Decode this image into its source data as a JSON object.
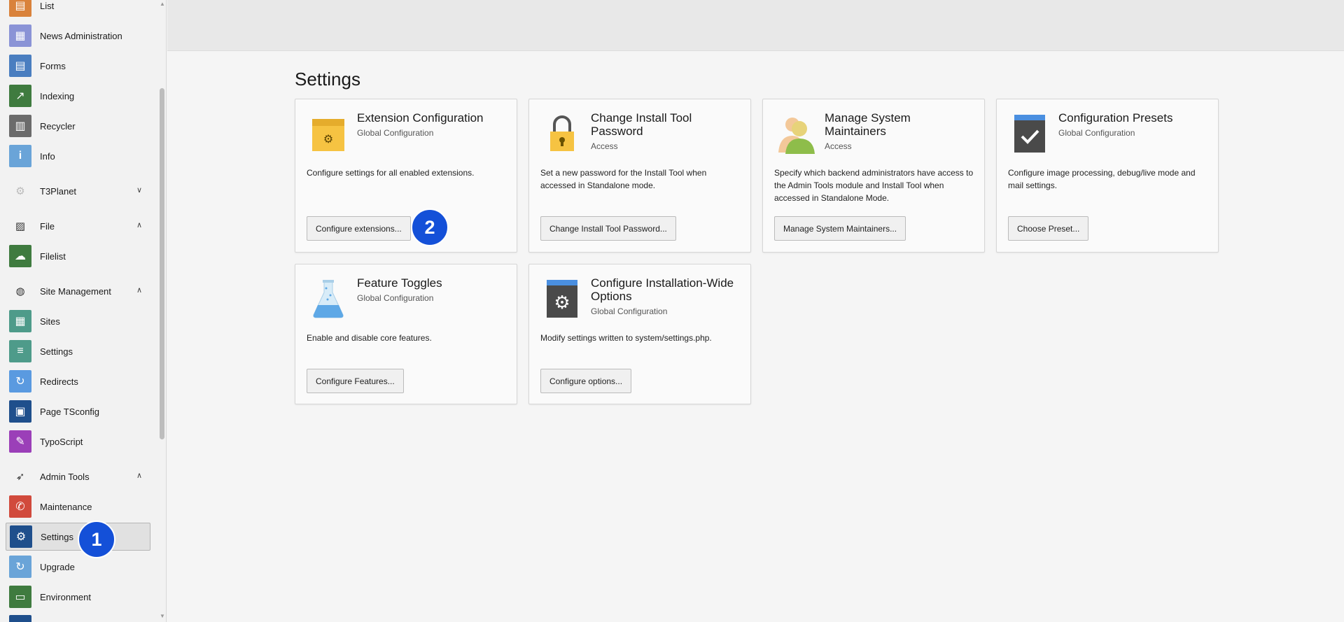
{
  "sidebar": {
    "items": [
      {
        "id": "list",
        "label": "List",
        "icon": "list-icon",
        "color": "#d9823b",
        "glyph": "▤"
      },
      {
        "id": "news",
        "label": "News Administration",
        "icon": "news-icon",
        "color": "#8a93d6",
        "glyph": "▦"
      },
      {
        "id": "forms",
        "label": "Forms",
        "icon": "forms-icon",
        "color": "#4a7ec0",
        "glyph": "▤"
      },
      {
        "id": "indexing",
        "label": "Indexing",
        "icon": "indexing-icon",
        "color": "#3f7b3f",
        "glyph": "↗"
      },
      {
        "id": "recycler",
        "label": "Recycler",
        "icon": "trash-icon",
        "color": "#6b6b6b",
        "glyph": "▥"
      },
      {
        "id": "info",
        "label": "Info",
        "icon": "info-icon",
        "color": "#6aa4d8",
        "glyph": "i"
      },
      {
        "id": "filelist",
        "label": "Filelist",
        "icon": "cloud-icon",
        "color": "#3f7b3f",
        "glyph": "☁"
      },
      {
        "id": "sites",
        "label": "Sites",
        "icon": "sites-icon",
        "color": "#4e9b8a",
        "glyph": "▦"
      },
      {
        "id": "settings-site",
        "label": "Settings",
        "icon": "sliders-icon",
        "color": "#4e9b8a",
        "glyph": "≡"
      },
      {
        "id": "redirects",
        "label": "Redirects",
        "icon": "redirect-icon",
        "color": "#5a9ae0",
        "glyph": "↻"
      },
      {
        "id": "page-tsconfig",
        "label": "Page TSconfig",
        "icon": "tsconfig-icon",
        "color": "#1f4f8c",
        "glyph": "▣"
      },
      {
        "id": "typoscript",
        "label": "TypoScript",
        "icon": "typoscript-icon",
        "color": "#9b3fb8",
        "glyph": "✎"
      },
      {
        "id": "maintenance",
        "label": "Maintenance",
        "icon": "wrench-icon",
        "color": "#d14a3c",
        "glyph": "✆"
      },
      {
        "id": "settings-admin",
        "label": "Settings",
        "icon": "gear-icon",
        "color": "#1f4f8c",
        "glyph": "⚙"
      },
      {
        "id": "upgrade",
        "label": "Upgrade",
        "icon": "upgrade-icon",
        "color": "#6aa4d8",
        "glyph": "↻"
      },
      {
        "id": "environment",
        "label": "Environment",
        "icon": "environment-icon",
        "color": "#3f7b3f",
        "glyph": "▭"
      }
    ],
    "groups": [
      {
        "id": "t3planet",
        "label": "T3Planet",
        "icon": "t3planet-icon",
        "chevron": "chevron-down-icon"
      },
      {
        "id": "file",
        "label": "File",
        "icon": "image-icon",
        "chevron": "chevron-up-icon"
      },
      {
        "id": "site-management",
        "label": "Site Management",
        "icon": "globe-icon",
        "chevron": "chevron-up-icon"
      },
      {
        "id": "admin-tools",
        "label": "Admin Tools",
        "icon": "rocket-icon",
        "chevron": "chevron-up-icon"
      }
    ]
  },
  "main": {
    "title": "Settings",
    "cards": [
      {
        "title": "Extension Configuration",
        "subtitle": "Global Configuration",
        "description": "Configure settings for all enabled extensions.",
        "button": "Configure extensions...",
        "icon": "extension-box-icon"
      },
      {
        "title": "Change Install Tool Password",
        "subtitle": "Access",
        "description": "Set a new password for the Install Tool when accessed in Standalone mode.",
        "button": "Change Install Tool Password...",
        "icon": "lock-icon"
      },
      {
        "title": "Manage System Maintainers",
        "subtitle": "Access",
        "description": "Specify which backend administrators have access to the Admin Tools module and Install Tool when accessed in Standalone Mode.",
        "button": "Manage System Maintainers...",
        "icon": "users-icon"
      },
      {
        "title": "Configuration Presets",
        "subtitle": "Global Configuration",
        "description": "Configure image processing, debug/live mode and mail settings.",
        "button": "Choose Preset...",
        "icon": "checkmark-icon"
      },
      {
        "title": "Feature Toggles",
        "subtitle": "Global Configuration",
        "description": "Enable and disable core features.",
        "button": "Configure Features...",
        "icon": "flask-icon"
      },
      {
        "title": "Configure Installation-Wide Options",
        "subtitle": "Global Configuration",
        "description": "Modify settings written to system/settings.php.",
        "button": "Configure options...",
        "icon": "cog-panel-icon"
      }
    ]
  },
  "badges": [
    "1",
    "2"
  ]
}
